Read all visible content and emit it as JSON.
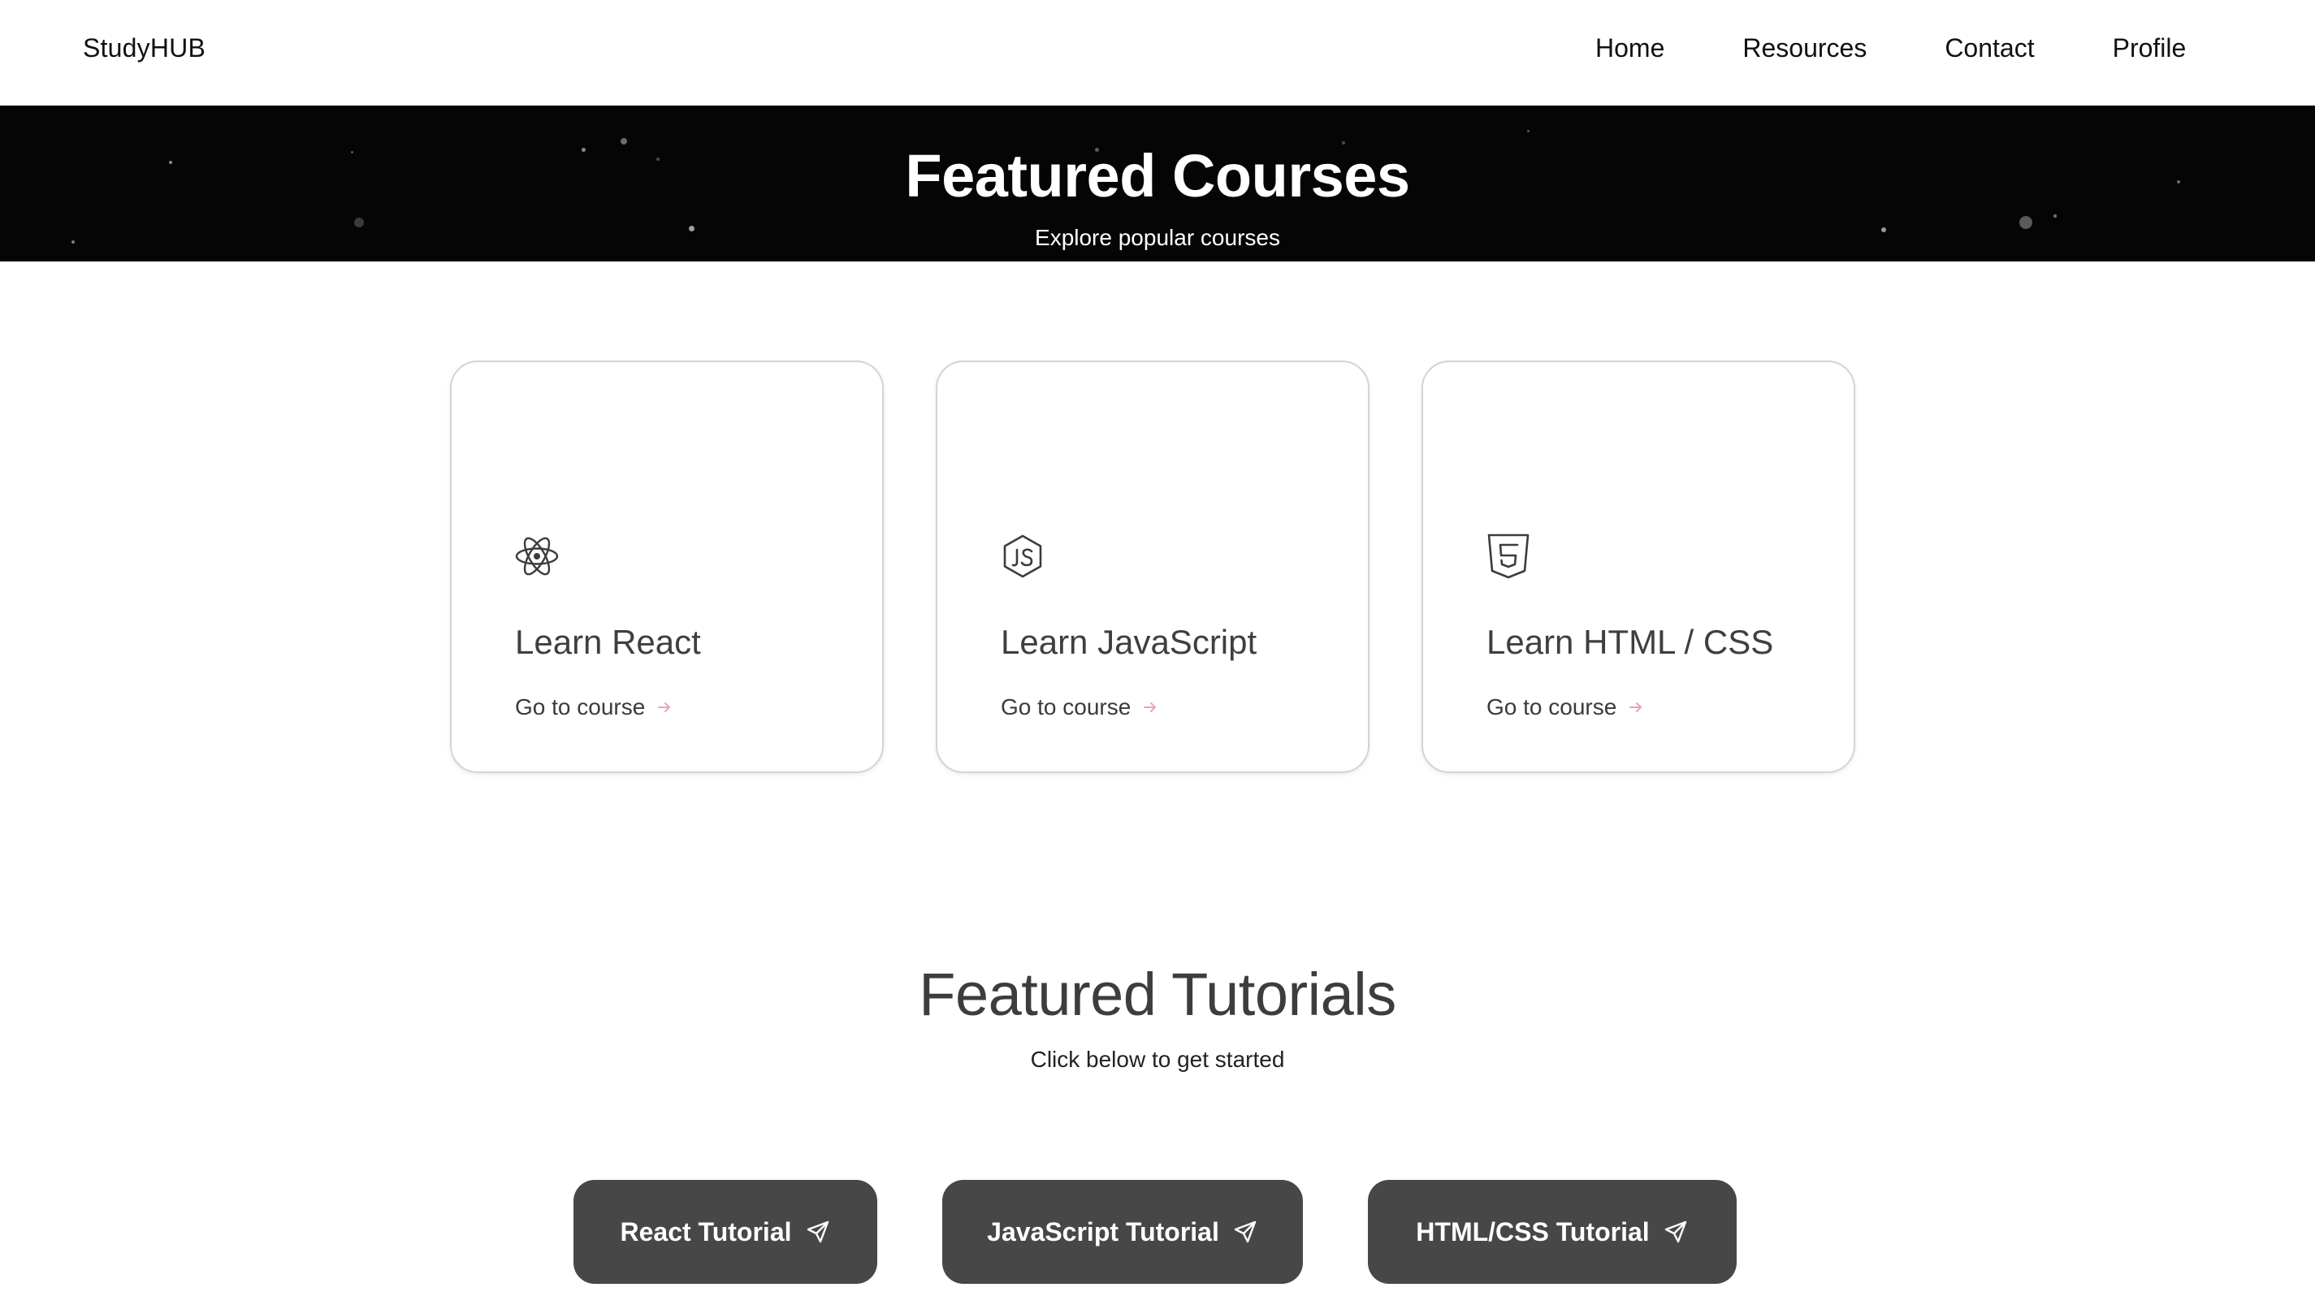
{
  "navbar": {
    "brand": "StudyHUB",
    "links": [
      "Home",
      "Resources",
      "Contact",
      "Profile"
    ]
  },
  "hero": {
    "title": "Featured Courses",
    "subtitle": "Explore popular courses"
  },
  "courses": [
    {
      "icon": "react-atom-icon",
      "title": "Learn React",
      "link": "Go to course"
    },
    {
      "icon": "javascript-hexagon-icon",
      "title": "Learn JavaScript",
      "link": "Go to course"
    },
    {
      "icon": "html5-shield-icon",
      "title": "Learn HTML / CSS",
      "link": "Go to course"
    }
  ],
  "tutorials": {
    "title": "Featured Tutorials",
    "subtitle": "Click below to get started",
    "buttons": [
      {
        "label": "React Tutorial",
        "icon": "send-icon"
      },
      {
        "label": "JavaScript Tutorial",
        "icon": "send-icon"
      },
      {
        "label": "HTML/CSS Tutorial",
        "icon": "send-icon"
      }
    ]
  },
  "colors": {
    "hero_background": "#050505",
    "card_border": "#d4d4d4",
    "link_arrow": "#e8a3b8",
    "tutorial_button": "#474747",
    "heading_text": "#3d3d3d"
  }
}
